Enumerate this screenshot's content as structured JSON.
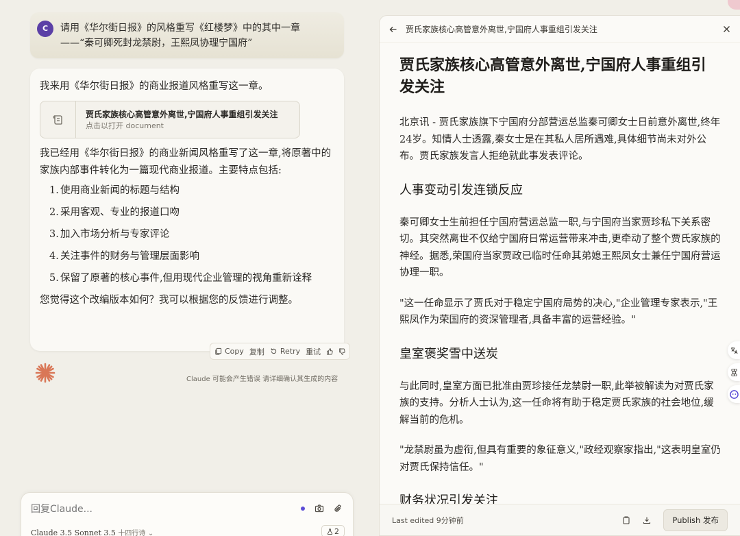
{
  "user_message": {
    "avatar_letter": "C",
    "text": "请用《华尔街日报》的风格重写《红楼梦》中的其中一章——“秦可卿死封龙禁尉，王熙凤协理宁国府”"
  },
  "assistant": {
    "intro": "我来用《华尔街日报》的商业报道风格重写这一章。",
    "artifact": {
      "title": "贾氏家族核心高管意外离世,宁国府人事重组引发关注",
      "subtitle": "点击以打开 document"
    },
    "summary": "我已经用《华尔街日报》的商业新闻风格重写了这一章,将原著中的家族内部事件转化为一篇现代商业报道。主要特点包括:",
    "features": [
      {
        "num": "1.",
        "text": "使用商业新闻的标题与结构"
      },
      {
        "num": "2.",
        "text": "采用客观、专业的报道口吻"
      },
      {
        "num": "3.",
        "text": "加入市场分析与专家评论"
      },
      {
        "num": "4.",
        "text": "关注事件的财务与管理层面影响"
      },
      {
        "num": "5.",
        "text": "保留了原著的核心事件,但用现代企业管理的视角重新诠释"
      }
    ],
    "closing": "您觉得这个改编版本如何？我可以根据您的反馈进行调整。"
  },
  "actions": {
    "copy": "Copy",
    "copy_cn": "复制",
    "retry": "Retry",
    "retry_cn": "重试"
  },
  "disclaimer": "Claude 可能会产生错误 请详细确认其生成的内容",
  "composer": {
    "placeholder": "回复Claude...",
    "model": "Claude 3.5 Sonnet 3.5",
    "model_style": "十四行诗",
    "count": "2"
  },
  "document": {
    "header_title": "贾氏家族核心高管意外离世,宁国府人事重组引发关注",
    "title": "贾氏家族核心高管意外离世,宁国府人事重组引发关注",
    "p1": "北京讯 - 贾氏家族旗下宁国府分部营运总监秦可卿女士日前意外离世,终年24岁。知情人士透露,秦女士是在其私人居所遇难,具体细节尚未对外公布。贾氏家族发言人拒绝就此事发表评论。",
    "h2a": "人事变动引发连锁反应",
    "p2": "秦可卿女士生前担任宁国府营运总监一职,与宁国府当家贾珍私下关系密切。其突然离世不仅给宁国府日常运营带来冲击,更牵动了整个贾氏家族的神经。据悉,荣国府当家贾政已临时任命其弟媳王熙凤女士兼任宁国府营运协理一职。",
    "p3": "\"这一任命显示了贾氏对于稳定宁国府局势的决心,\"企业管理专家表示,\"王熙凤作为荣国府的资深管理者,具备丰富的运营经验。\"",
    "h2b": "皇室褒奖雪中送炭",
    "p4": "与此同时,皇室方面已批准由贾珍接任龙禁尉一职,此举被解读为对贾氏家族的支持。分析人士认为,这一任命将有助于稳定贾氏家族的社会地位,缓解当前的危机。",
    "p5": "\"龙禁尉虽为虚衔,但具有重要的象征意义,\"政经观察家指出,\"这表明皇室仍对贾氏保持信任。\"",
    "h2c": "财务状况引发关注",
    "last_edited": "Last edited 9分钟前",
    "publish": "Publish 发布"
  },
  "colors": {
    "background": "#f1efe8",
    "avatar": "#5b3fa6",
    "accent_dot": "#5b4cd6",
    "spark": "#d97757"
  }
}
